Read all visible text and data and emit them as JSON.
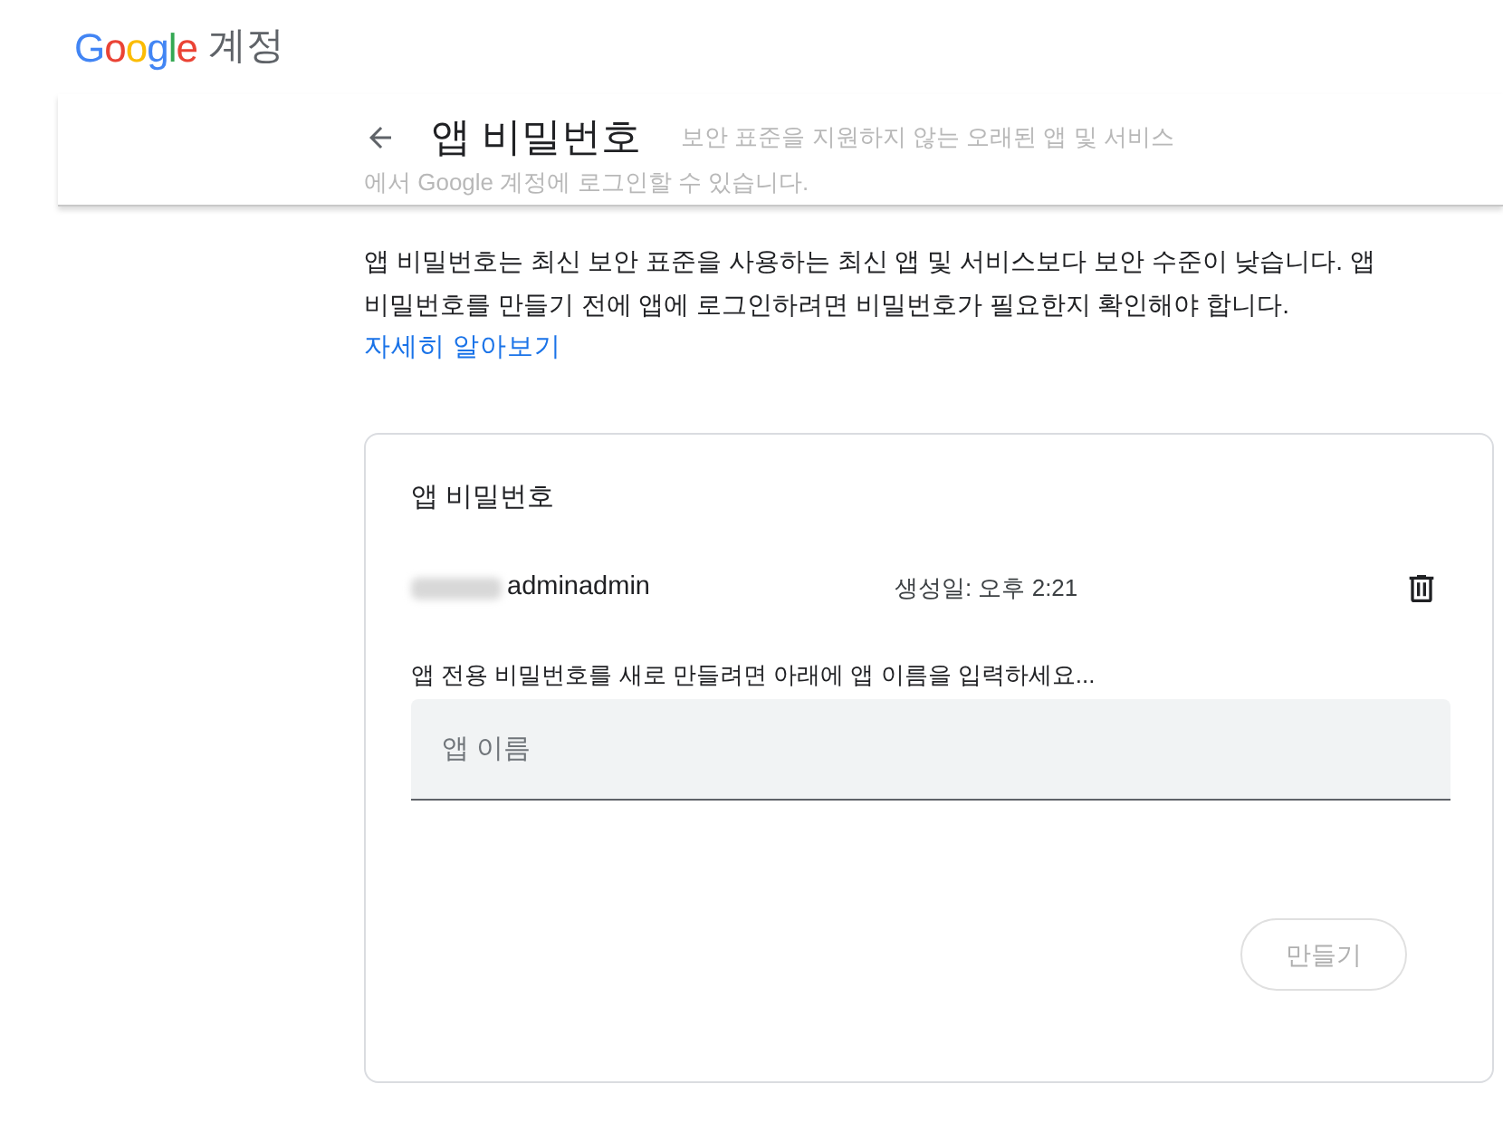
{
  "header": {
    "logo": "Google",
    "product": "계정"
  },
  "page": {
    "title": "앱 비밀번호",
    "faded_lines": [
      "보안 표준을 지원하지 않는 오래된 앱 및 서비스",
      "에서 Google 계정에 로그인할 수 있습니다."
    ]
  },
  "intro": "앱 비밀번호는 최신 보안 표준을 사용하는 최신 앱 및 서비스보다 보안 수준이 낮습니다. 앱 비밀번호를 만들기 전에 앱에 로그인하려면 비밀번호가 필요한지 확인해야 합니다.",
  "learn_more": "자세히 알아보기",
  "card": {
    "title": "앱 비밀번호",
    "passwords": [
      {
        "name": "adminadmin",
        "created": "생성일: 오후 2:21"
      }
    ],
    "instruction": "앱 전용 비밀번호를 새로 만들려면 아래에 앱 이름을 입력하세요...",
    "field": {
      "placeholder": "앱 이름"
    },
    "create_button": {
      "label": "만들기",
      "disabled": true
    }
  }
}
